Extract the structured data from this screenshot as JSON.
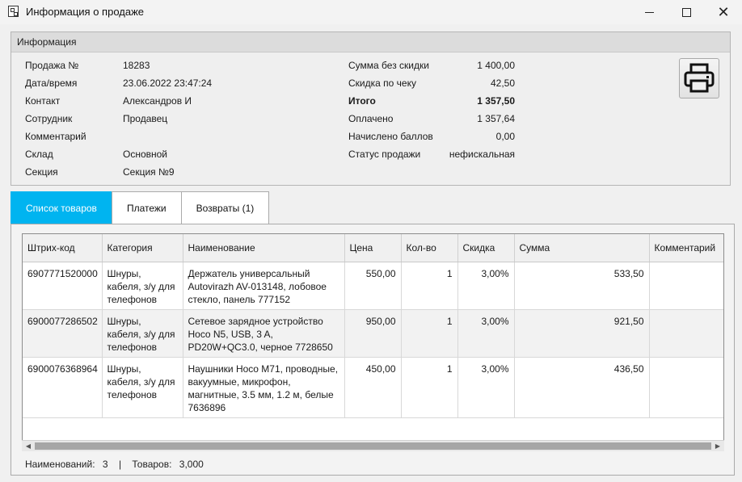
{
  "window": {
    "title": "Информация о продаже"
  },
  "info": {
    "header": "Информация",
    "left": [
      {
        "label": "Продажа №",
        "value": "18283"
      },
      {
        "label": "Дата/время",
        "value": "23.06.2022 23:47:24"
      },
      {
        "label": "Контакт",
        "value": "Александров И"
      },
      {
        "label": "Сотрудник",
        "value": "Продавец"
      },
      {
        "label": "Комментарий",
        "value": ""
      },
      {
        "label": "Склад",
        "value": "Основной"
      },
      {
        "label": "Секция",
        "value": "Секция №9"
      }
    ],
    "right": [
      {
        "label": "Сумма без скидки",
        "value": "1 400,00"
      },
      {
        "label": "Скидка по чеку",
        "value": "42,50"
      },
      {
        "label": "Итого",
        "value": "1 357,50"
      },
      {
        "label": "Оплачено",
        "value": "1 357,64"
      },
      {
        "label": "Начислено баллов",
        "value": "0,00"
      },
      {
        "label": "Статус продажи",
        "value": "нефискальная"
      }
    ]
  },
  "tabs": [
    {
      "label": "Список товаров",
      "active": true
    },
    {
      "label": "Платежи",
      "active": false
    },
    {
      "label": "Возвраты (1)",
      "active": false
    }
  ],
  "grid": {
    "columns": [
      "Штрих-код",
      "Категория",
      "Наименование",
      "Цена",
      "Кол-во",
      "Скидка",
      "Сумма",
      "Комментарий"
    ],
    "rows": [
      {
        "barcode": "6907771520000",
        "category": "Шнуры, кабеля, з/у для телефонов",
        "name": "Держатель универсальный Autovirazh AV-013148, лобовое стекло, панель 777152",
        "price": "550,00",
        "qty": "1",
        "discount": "3,00%",
        "sum": "533,50",
        "comment": ""
      },
      {
        "barcode": "6900077286502",
        "category": "Шнуры, кабеля, з/у для телефонов",
        "name": "Сетевое зарядное устройство Hoco N5, USB,  3 A, PD20W+QC3.0, черное 7728650",
        "price": "950,00",
        "qty": "1",
        "discount": "3,00%",
        "sum": "921,50",
        "comment": ""
      },
      {
        "barcode": "6900076368964",
        "category": "Шнуры, кабеля, з/у для телефонов",
        "name": "Наушники Hoco M71, проводные, вакуумные, микрофон, магнитные, 3.5 мм, 1.2 м, белые 7636896",
        "price": "450,00",
        "qty": "1",
        "discount": "3,00%",
        "sum": "436,50",
        "comment": ""
      }
    ]
  },
  "status": {
    "items_label": "Наименований:",
    "items_value": "3",
    "separator": "|",
    "goods_label": "Товаров:",
    "goods_value": "3,000"
  },
  "colors": {
    "accent": "#00b4f0"
  },
  "icons": {
    "print": "printer-icon",
    "app": "app-icon"
  }
}
